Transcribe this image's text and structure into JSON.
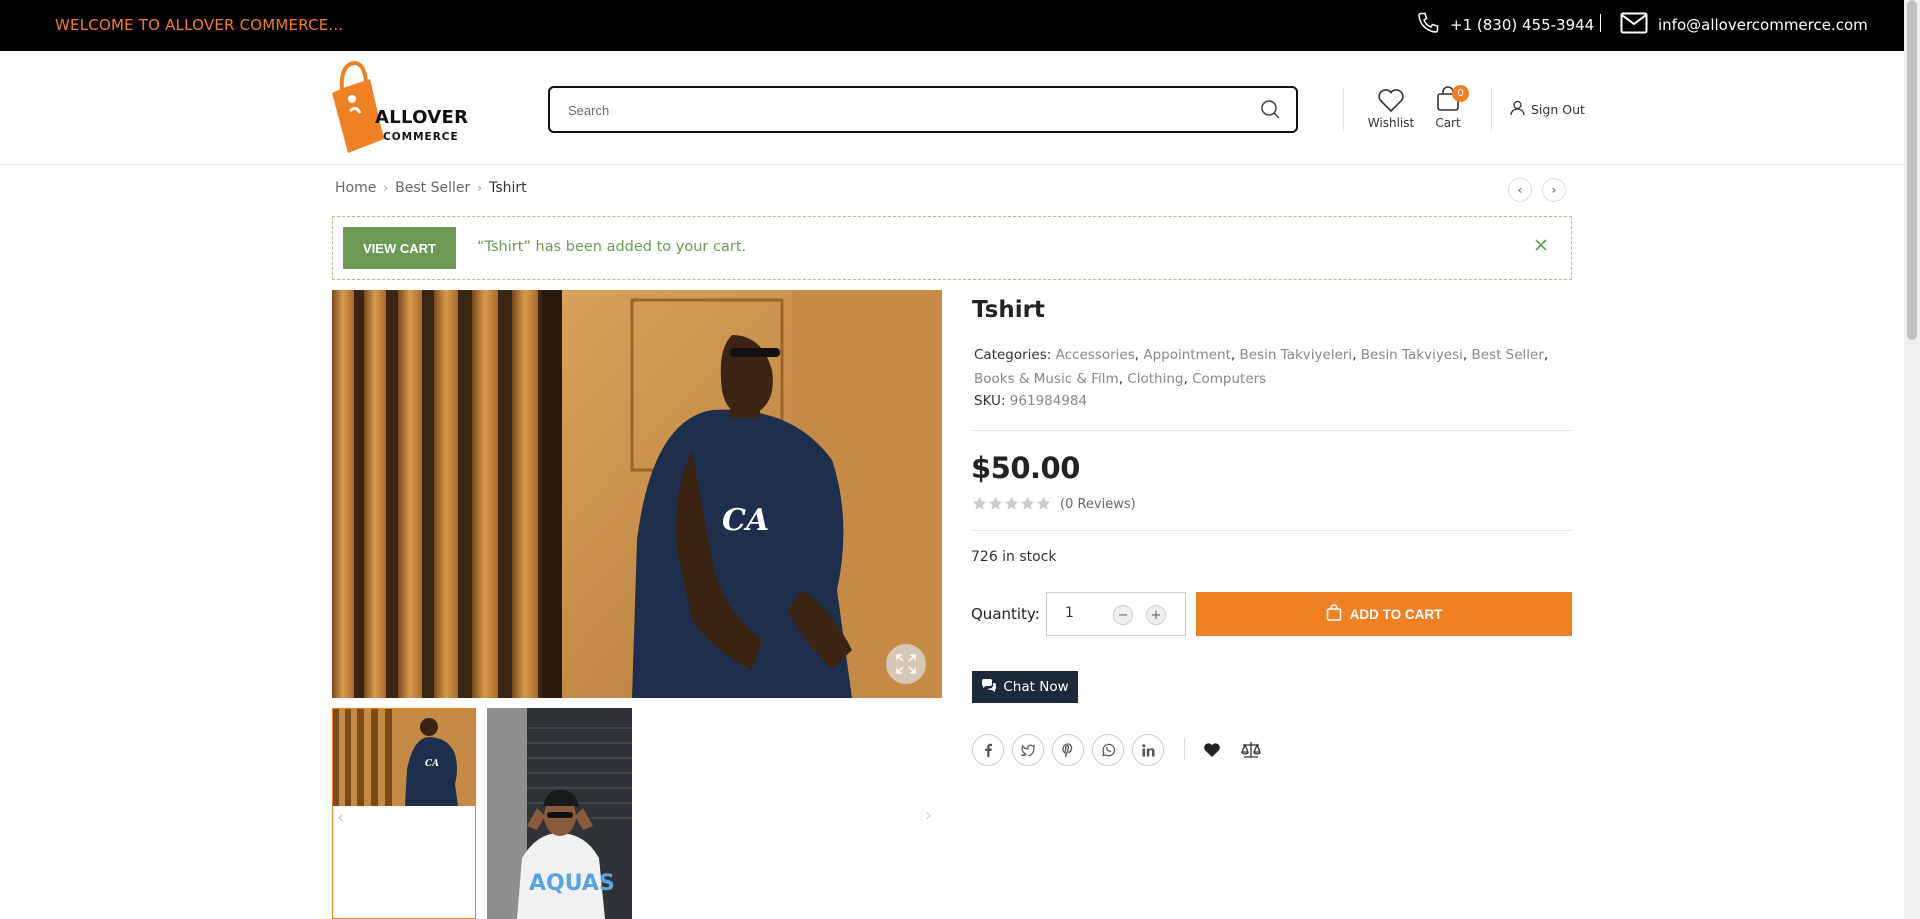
{
  "topbar": {
    "welcome": "WELCOME TO ALLOVER COMMERCE...",
    "phone": "+1 (830) 455-3944",
    "email": "info@allovercommerce.com"
  },
  "header": {
    "logo_line1": "ALLOVER",
    "logo_line2": "COMMERCE",
    "search_placeholder": "Search",
    "wishlist_label": "Wishlist",
    "cart_label": "Cart",
    "cart_count": "0",
    "signout_label": "Sign Out"
  },
  "breadcrumb": {
    "items": [
      "Home",
      "Best Seller",
      "Tshirt"
    ]
  },
  "notice": {
    "button": "VIEW CART",
    "message": "“Tshirt” has been added to your cart."
  },
  "product": {
    "title": "Tshirt",
    "categories_label": "Categories:",
    "categories": [
      "Accessories",
      "Appointment",
      "Besin Takviyeleri",
      "Besin Takviyesi",
      "Best Seller",
      "Books & Music & Film",
      "Clothing",
      "Computers"
    ],
    "sku_label": "SKU:",
    "sku": "961984984",
    "price": "$50.00",
    "rating": 0,
    "reviews": "(0 Reviews)",
    "stock": "726 in stock",
    "quantity_label": "Quantity:",
    "quantity": "1",
    "add_to_cart": "ADD TO CART",
    "chat": "Chat Now"
  },
  "colors": {
    "accent": "#f08024",
    "success": "#6c9a55",
    "dark": "#000000",
    "chat_bg": "#1b2a3a"
  },
  "icons": [
    "phone-icon",
    "mail-icon",
    "search-icon",
    "heart-icon",
    "bag-icon",
    "user-icon",
    "close-icon",
    "expand-icon",
    "star-icon",
    "facebook-icon",
    "twitter-icon",
    "pinterest-icon",
    "whatsapp-icon",
    "linkedin-icon",
    "compare-icon"
  ]
}
